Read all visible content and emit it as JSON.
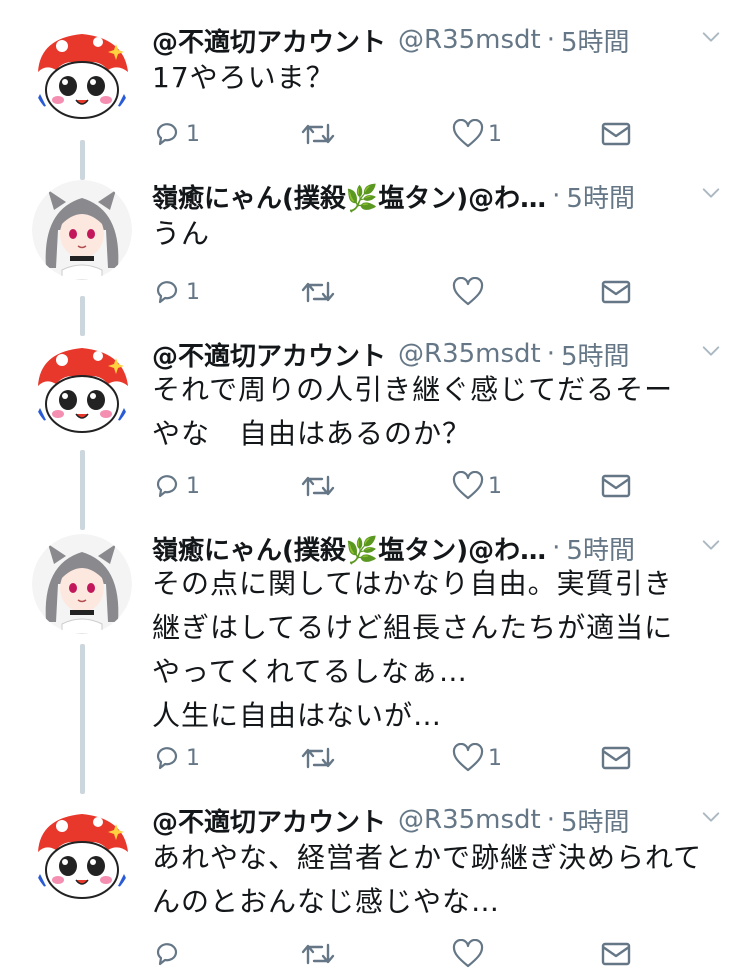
{
  "tweets": [
    {
      "avatar": "red-mushroom-character-avatar",
      "name": "@不適切アカウント",
      "handle": "@R35msdt",
      "time": "5時間",
      "text": "17やろいま？",
      "replies": "1",
      "retweets": "",
      "likes": "1"
    },
    {
      "avatar": "gray-hair-girl-avatar",
      "name": "嶺癒にゃん(撲殺🌿塩タン)@わ…",
      "handle": "",
      "time": "5時間",
      "text": "うん",
      "replies": "1",
      "retweets": "",
      "likes": ""
    },
    {
      "avatar": "red-mushroom-character-avatar",
      "name": "@不適切アカウント",
      "handle": "@R35msdt",
      "time": "5時間",
      "text": "それで周りの人引き継ぐ感じてだるそー\nやな　自由はあるのか？",
      "replies": "1",
      "retweets": "",
      "likes": "1"
    },
    {
      "avatar": "gray-hair-girl-avatar",
      "name": "嶺癒にゃん(撲殺🌿塩タン)@わ…",
      "handle": "",
      "time": "5時間",
      "text": "その点に関してはかなり自由。実質引き\n継ぎはしてるけど組長さんたちが適当に\nやってくれてるしなぁ…\n人生に自由はないが…",
      "replies": "1",
      "retweets": "",
      "likes": "1"
    },
    {
      "avatar": "red-mushroom-character-avatar",
      "name": "@不適切アカウント",
      "handle": "@R35msdt",
      "time": "5時間",
      "text": "あれやな、経営者とかで跡継ぎ決められて\nんのとおんなじ感じやな…",
      "replies": "",
      "retweets": "",
      "likes": ""
    }
  ],
  "colors": {
    "text": "#14171a",
    "muted": "#657786",
    "thread_line": "#ccd6dd",
    "avatar_red": "#e8382b"
  }
}
